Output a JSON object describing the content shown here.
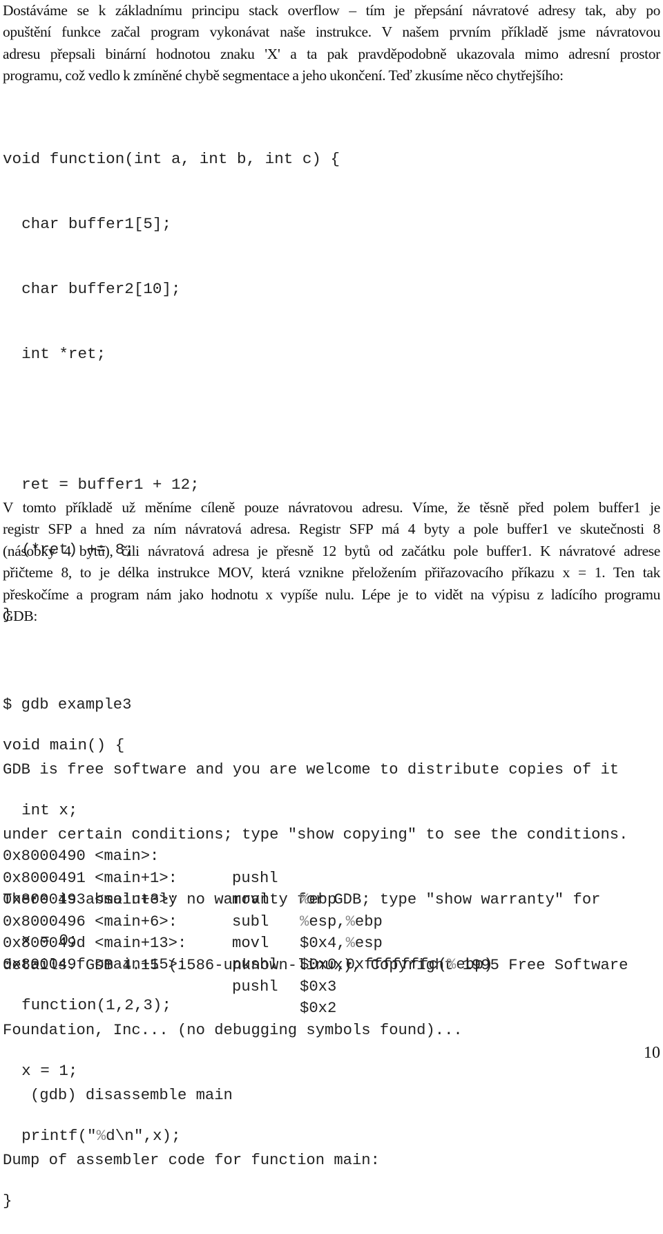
{
  "intro_paragraph": {
    "lines": [
      "Dostáváme se k základnímu principu stack overflow – tím je přepsání návratové adresy tak, aby po",
      "opuštění funkce začal program vykonávat naše instrukce. V našem prvním příkladě jsme návratovou",
      "adresu přepsali binární hodnotou znaku 'X' a ta pak pravděpodobně ukazovala mimo adresní prostor",
      "programu, což vedlo k zmíněné chybě segmentace a jeho ukončení. Teď zkusíme něco chytřejšího:"
    ]
  },
  "code_listing": {
    "lines": [
      "void function(int a, int b, int c) {",
      "  char buffer1[5];",
      "  char buffer2[10];",
      "  int *ret;",
      "",
      "  ret = buffer1 + 12;",
      "  (*ret) += 8;",
      "}",
      "",
      "void main() {",
      "  int x;",
      "",
      "  x = 0;",
      "  function(1,2,3);",
      "  x = 1;",
      "  printf(\"%d\\n\",x);",
      "}"
    ]
  },
  "explanation_paragraph": {
    "lines": [
      " V tomto příkladě už měníme cíleně pouze návratovou adresu. Víme, že těsně před polem buffer1 je",
      "registr SFP a hned za ním návratová adresa. Registr SFP má 4 byty a pole buffer1 ve skutečnosti 8",
      "(násobky 4 bytů), čili návratová adresa je přesně 12 bytů od začátku pole buffer1. K návratové adrese",
      "přičteme 8, to je délka instrukce MOV, která vznikne přeložením přiřazovacího příkazu x = 1. Ten tak",
      "přeskočíme a program nám jako hodnotu x vypíše nulu. Lépe je to vidět na výpisu z ladícího programu",
      "GDB:"
    ]
  },
  "gdb_session": {
    "lines": [
      "$ gdb example3",
      "GDB is free software and you are welcome to distribute copies of it",
      "under certain conditions; type \"show copying\" to see the conditions.",
      "There is absolutely no warranty for GDB; type \"show warranty\" for",
      "details. GDB 4.15 (i586-unknown-linux), Copyright 1995 Free Software",
      "Foundation, Inc... (no debugging symbols found)...",
      "   (gdb) disassemble main",
      "Dump of assembler code for function main:"
    ],
    "disassembly": [
      {
        "address": "0x8000490 <main>:",
        "op": "pushl",
        "args": "%ebp"
      },
      {
        "address": "0x8000491 <main+1>:",
        "op": "movl",
        "args": "%esp,%ebp"
      },
      {
        "address": "0x8000493 <main+3>:",
        "op": "subl",
        "args": "$0x4,%esp"
      },
      {
        "address": "0x8000496 <main+6>:",
        "op": "movl",
        "args": "$0x0,0xfffffffc(%ebp)"
      },
      {
        "address": "0x800049d <main+13>:",
        "op": "pushl",
        "args": "$0x3"
      },
      {
        "address": "0x800049f <main+15>:",
        "op": "pushl",
        "args": "$0x2"
      }
    ]
  },
  "page_number": "10"
}
